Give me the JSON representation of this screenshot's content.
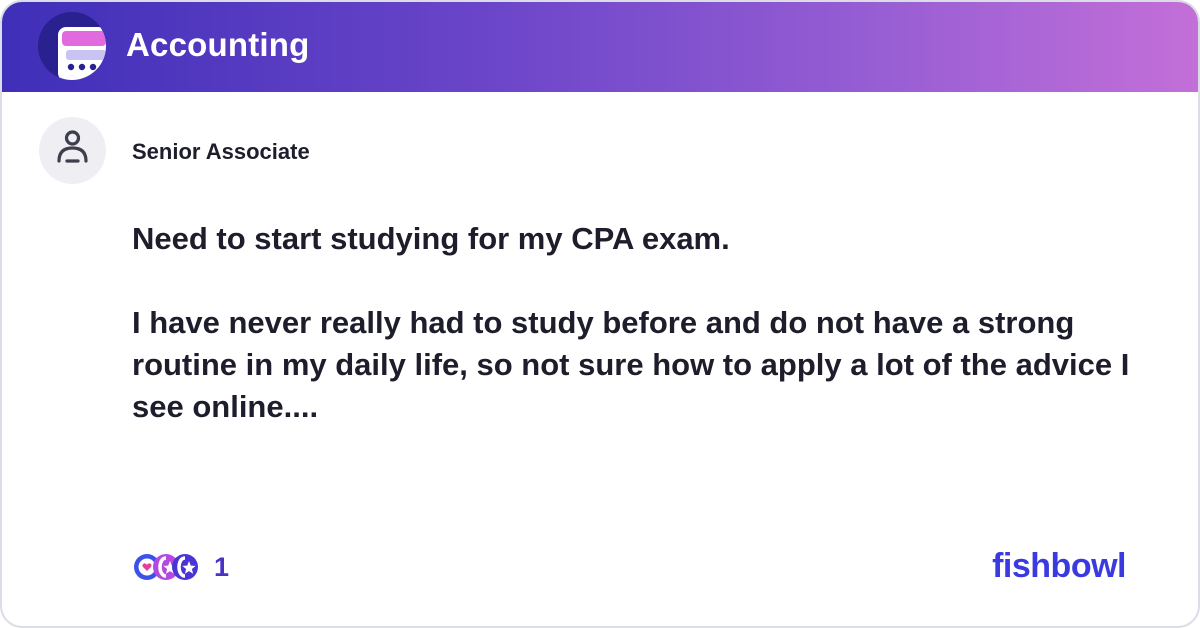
{
  "header": {
    "title": "Accounting",
    "background_gradient": [
      "#3f2fb8",
      "#6a45c9",
      "#9a5fd4",
      "#c36fd8"
    ]
  },
  "logo": {
    "icon": "bowl-chat-icon"
  },
  "post": {
    "author_icon": "user-avatar-icon",
    "author": "Senior Associate",
    "paragraph_1": "Need to start studying for my CPA exam.",
    "paragraph_2": "I have never really had to study before and do not have a strong routine in my daily life, so not sure how to apply a lot of the advice I see online...."
  },
  "reactions": {
    "icons": [
      "heart-reaction-icon",
      "star-reaction-icon",
      "clap-reaction-icon"
    ],
    "count": "1"
  },
  "brand": {
    "name": "fishbowl",
    "color": "#3a3ae0"
  }
}
